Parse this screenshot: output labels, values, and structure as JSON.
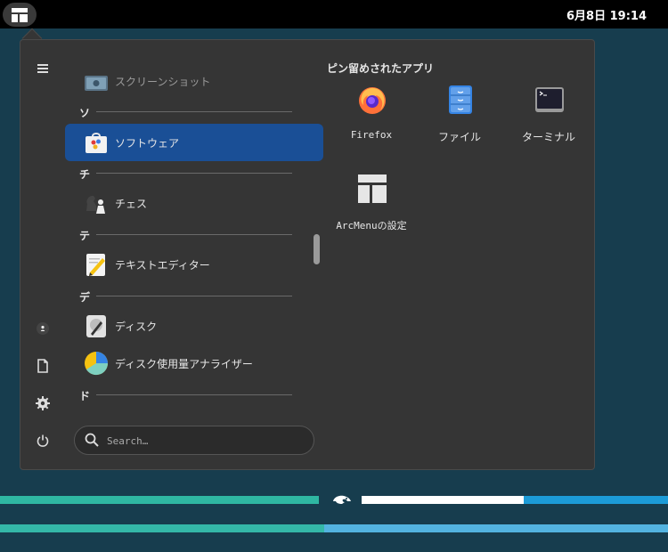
{
  "topbar": {
    "clock": "6月8日  19:14"
  },
  "colors": {
    "accent": "#1a4f96",
    "desktop": "#173d4e",
    "panel": "#353535"
  },
  "sidebar": {
    "items": [
      {
        "name": "hamburger-icon"
      },
      {
        "name": "user-icon"
      },
      {
        "name": "documents-icon"
      },
      {
        "name": "gear-icon"
      },
      {
        "name": "power-icon"
      }
    ]
  },
  "app_list": {
    "sections": [
      "ソ",
      "チ",
      "テ",
      "デ",
      "ド"
    ],
    "apps": [
      {
        "label": "スクリーンショット",
        "icon": "screenshot-icon"
      },
      {
        "label": "ソフトウェア",
        "icon": "software-icon",
        "selected": true
      },
      {
        "label": "チェス",
        "icon": "chess-icon"
      },
      {
        "label": "テキストエディター",
        "icon": "text-editor-icon"
      },
      {
        "label": "ディスク",
        "icon": "disks-icon"
      },
      {
        "label": "ディスク使用量アナライザー",
        "icon": "disk-usage-icon"
      }
    ]
  },
  "search": {
    "placeholder": "Search…"
  },
  "pinned": {
    "title": "ピン留めされたアプリ",
    "apps": [
      {
        "label": "Firefox",
        "icon": "firefox-icon"
      },
      {
        "label": "ファイル",
        "icon": "files-icon"
      },
      {
        "label": "ターミナル",
        "icon": "terminal-icon"
      },
      {
        "label": "ArcMenuの設定",
        "icon": "arcmenu-settings-icon"
      }
    ]
  }
}
